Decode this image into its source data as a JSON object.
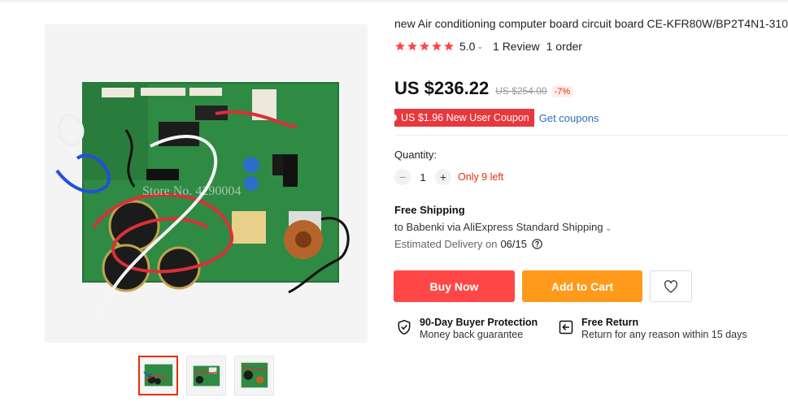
{
  "product": {
    "title": "new Air conditioning computer board circuit board CE-KFR80W/BP2T4N1-310",
    "rating_value": "5.0",
    "rating_stars": 5,
    "reviews": "1 Review",
    "orders": "1 order"
  },
  "price": {
    "current": "US $236.22",
    "original": "US $254.00",
    "discount": "-7%"
  },
  "coupon": {
    "label": "US $1.96 New User Coupon",
    "link": "Get coupons"
  },
  "quantity": {
    "label": "Quantity:",
    "value": "1",
    "minus": "−",
    "plus": "+",
    "stock_note": "Only 9 left"
  },
  "shipping": {
    "title": "Free Shipping",
    "destination": "to Babenki via AliExpress Standard Shipping",
    "delivery_label": "Estimated Delivery on",
    "delivery_date": "06/15"
  },
  "actions": {
    "buy_now": "Buy Now",
    "add_to_cart": "Add to Cart"
  },
  "protection": [
    {
      "title": "90-Day Buyer Protection",
      "desc": "Money back guarantee",
      "icon": "shield-check-icon"
    },
    {
      "title": "Free Return",
      "desc": "Return for any reason within 15 days",
      "icon": "return-arrow-icon"
    }
  ],
  "gallery": {
    "watermark": "Store No. 4290004",
    "thumbnail_count": 3,
    "active_index": 0
  },
  "colors": {
    "accent_red": "#ff4747",
    "accent_orange": "#ff9a1b",
    "coupon_red": "#e8383b",
    "star": "#ff4747",
    "link_blue": "#2b6fc6",
    "pcb_green": "#2f8a43"
  }
}
